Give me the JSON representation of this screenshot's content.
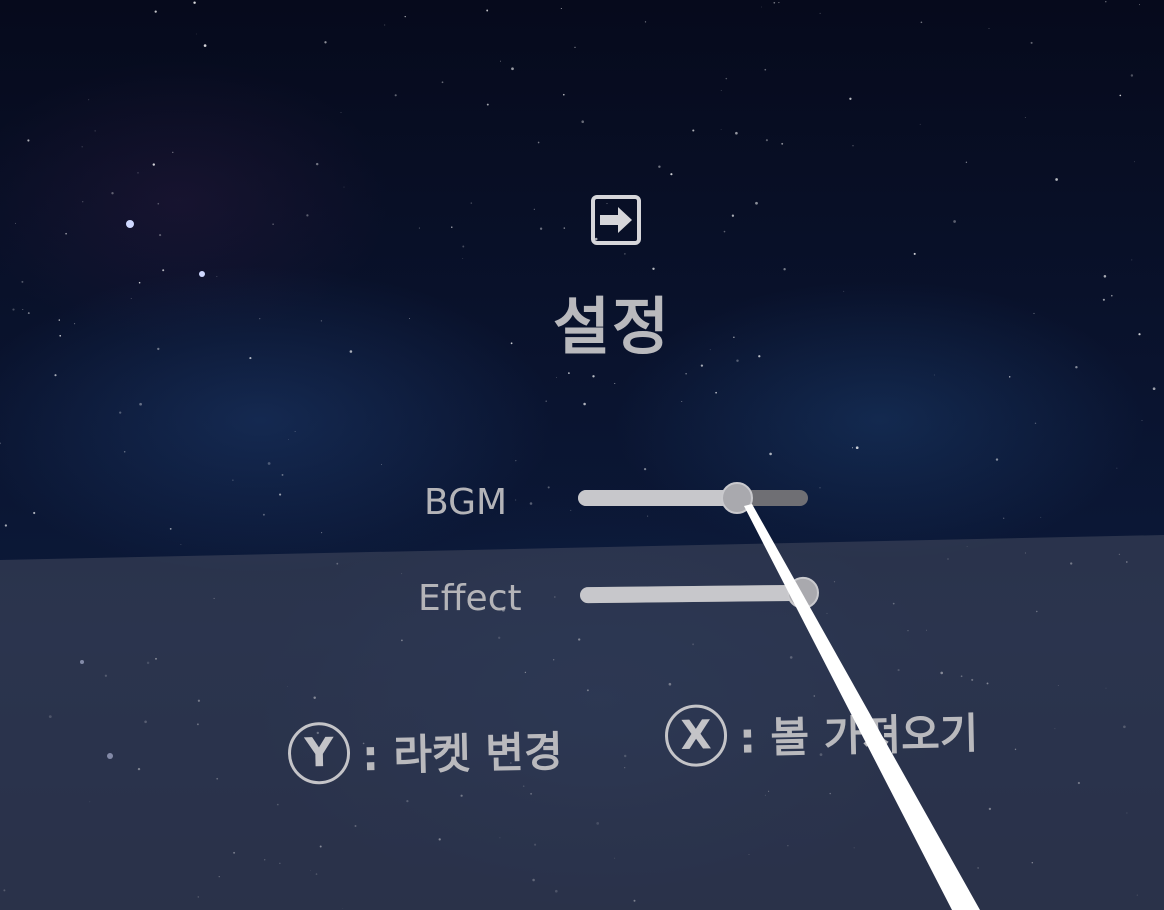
{
  "menu": {
    "exit_icon": "exit-icon",
    "title": "설정"
  },
  "sliders": [
    {
      "label": "BGM",
      "value_fraction": 0.69
    },
    {
      "label": "Effect",
      "value_fraction": 0.97
    }
  ],
  "hints": [
    {
      "button": "Y",
      "text": ": 라켓 변경"
    },
    {
      "button": "X",
      "text": ": 볼 가져오기"
    }
  ],
  "colors": {
    "text": "#b9b9bd",
    "slider_fill": "#c7c7cb",
    "slider_track": "#6f6f74",
    "ray": "#ffffff"
  }
}
